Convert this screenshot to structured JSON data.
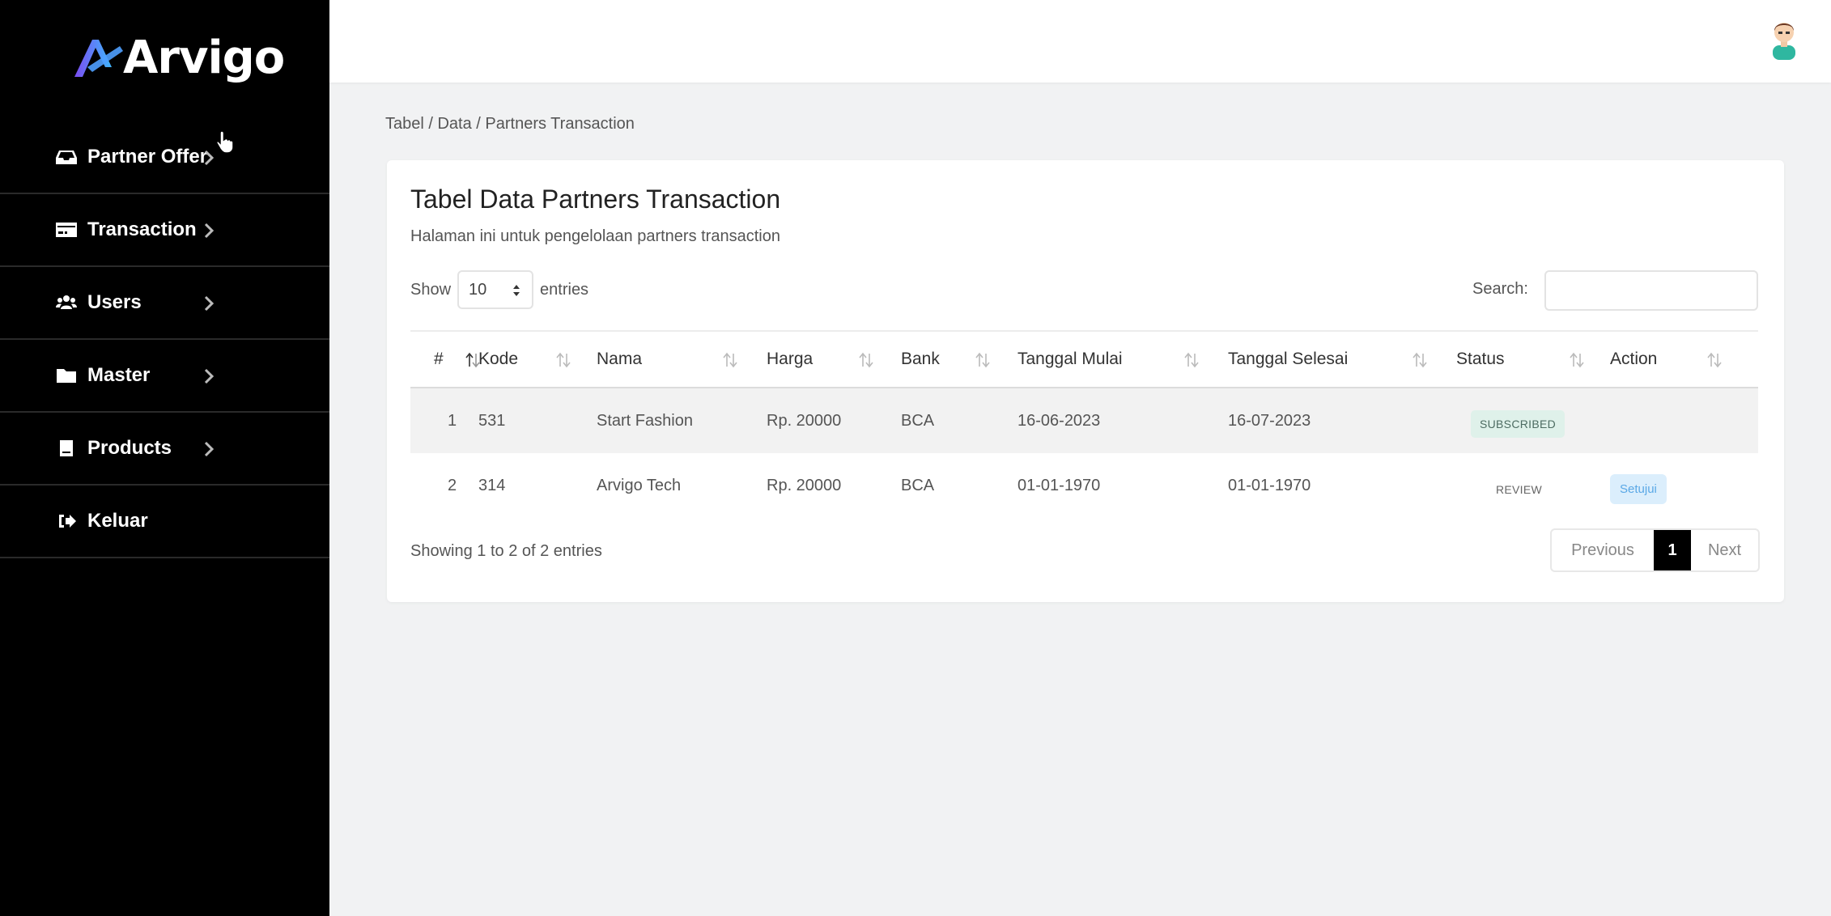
{
  "app": {
    "brand": "Arvigo"
  },
  "sidebar": {
    "items": [
      {
        "label": "Partner Offer",
        "icon": "inbox-icon",
        "has_chevron": true
      },
      {
        "label": "Transaction",
        "icon": "credit-card-icon",
        "has_chevron": true
      },
      {
        "label": "Users",
        "icon": "users-icon",
        "has_chevron": true
      },
      {
        "label": "Master",
        "icon": "folder-icon",
        "has_chevron": true
      },
      {
        "label": "Products",
        "icon": "book-icon",
        "has_chevron": true
      },
      {
        "label": "Keluar",
        "icon": "logout-icon",
        "has_chevron": false
      }
    ]
  },
  "breadcrumb": "Tabel / Data / Partners Transaction",
  "card": {
    "title": "Tabel Data Partners Transaction",
    "subtitle": "Halaman ini untuk pengelolaan partners transaction"
  },
  "table_controls": {
    "show_label": "Show",
    "page_size": "10",
    "entries_label": "entries",
    "search_label": "Search:",
    "search_value": ""
  },
  "table": {
    "columns": [
      "#",
      "Kode",
      "Nama",
      "Harga",
      "Bank",
      "Tanggal Mulai",
      "Tanggal Selesai",
      "Status",
      "Action"
    ],
    "rows": [
      {
        "no": "1",
        "kode": "531",
        "nama": "Start Fashion",
        "harga": "Rp. 20000",
        "bank": "BCA",
        "mulai": "16-06-2023",
        "selesai": "16-07-2023",
        "status": "SUBSCRIBED",
        "action": ""
      },
      {
        "no": "2",
        "kode": "314",
        "nama": "Arvigo Tech",
        "harga": "Rp. 20000",
        "bank": "BCA",
        "mulai": "01-01-1970",
        "selesai": "01-01-1970",
        "status": "REVIEW",
        "action": "Setujui"
      }
    ]
  },
  "footer": {
    "info": "Showing 1 to 2 of 2 entries",
    "previous": "Previous",
    "current_page": "1",
    "next": "Next"
  },
  "colors": {
    "sidebar_bg": "#000000",
    "subscribed_bg": "#dff1ea",
    "setujui_bg": "#dbeefc",
    "setujui_text": "#5aa8e6",
    "active_page_bg": "#000000"
  }
}
